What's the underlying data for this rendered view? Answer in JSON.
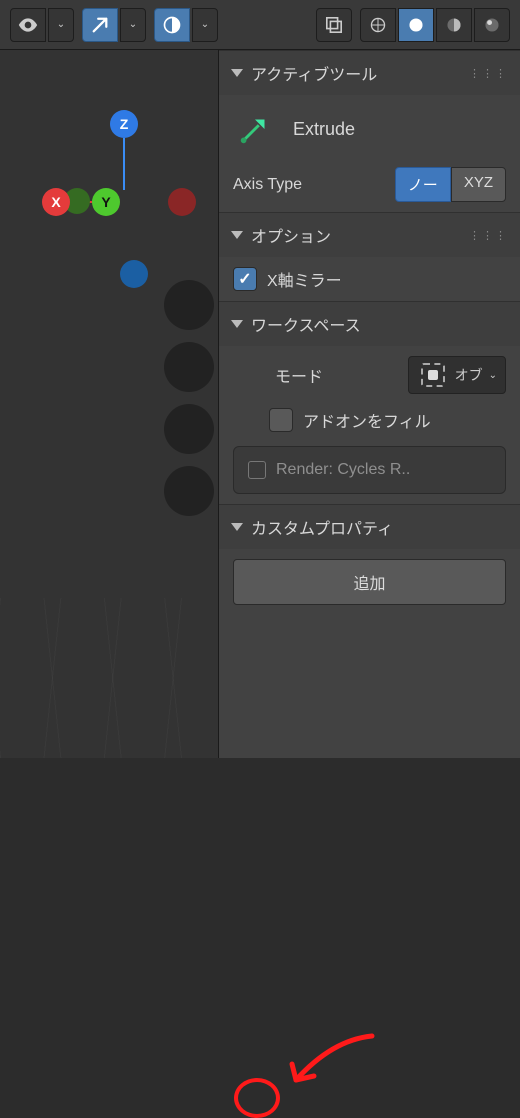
{
  "header": {
    "visibility_icon": "eye-icon",
    "arrow_icon": "arrow-out-icon",
    "orientation_icon": "orientation-icon",
    "overlays_icon": "overlays-icon",
    "shading": [
      "wireframe-icon",
      "solid-icon",
      "matcap-icon",
      "rendered-icon"
    ]
  },
  "gizmo": {
    "x": "X",
    "y": "Y",
    "z": "Z"
  },
  "panel": {
    "active_tool": {
      "title": "アクティブツール",
      "tool_name": "Extrude",
      "axis_label": "Axis Type",
      "axis_opt_normal": "ノー",
      "axis_opt_xyz": "XYZ"
    },
    "options": {
      "title": "オプション",
      "x_mirror_label": "X軸ミラー",
      "x_mirror_checked": true
    },
    "workspace": {
      "title": "ワークスペース",
      "mode_label": "モード",
      "mode_value": "オブ",
      "addons_label": "アドオンをフィル",
      "render_label": "Render: Cycles R.."
    },
    "custom_props": {
      "title": "カスタムプロパティ",
      "add_label": "追加"
    }
  }
}
